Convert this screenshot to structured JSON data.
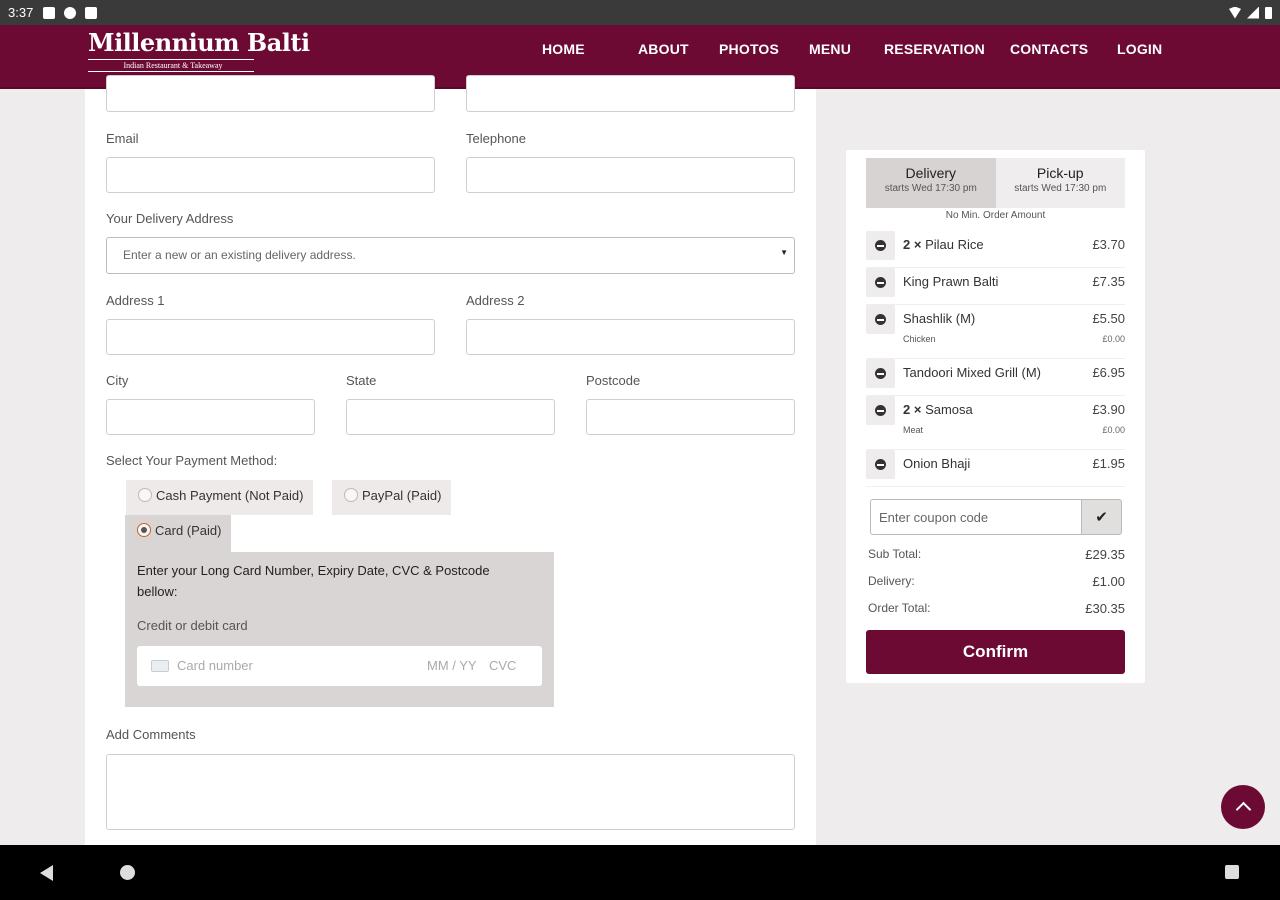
{
  "status_bar": {
    "time": "3:37"
  },
  "header": {
    "logo_title": "Millennium Balti",
    "logo_subtitle": "Indian Restaurant & Takeaway",
    "nav": [
      "HOME",
      "ABOUT",
      "PHOTOS",
      "MENU",
      "RESERVATION",
      "CONTACTS",
      "LOGIN"
    ]
  },
  "form": {
    "email_label": "Email",
    "telephone_label": "Telephone",
    "delivery_address_label": "Your Delivery Address",
    "delivery_address_placeholder": "Enter a new or an existing delivery address.",
    "address1_label": "Address 1",
    "address2_label": "Address 2",
    "city_label": "City",
    "state_label": "State",
    "postcode_label": "Postcode",
    "payment_label": "Select Your Payment Method:",
    "payment_options": [
      "Cash Payment (Not Paid)",
      "PayPal (Paid)",
      "Card (Paid)"
    ],
    "selected_payment": "Card (Paid)",
    "card_instructions": "Enter your Long Card Number, Expiry Date, CVC & Postcode bellow:",
    "card_subtitle": "Credit or debit card",
    "card_number_placeholder": "Card number",
    "card_expiry_placeholder": "MM / YY",
    "card_cvc_placeholder": "CVC",
    "comments_label": "Add Comments"
  },
  "order": {
    "tabs": [
      {
        "label": "Delivery",
        "sub": "starts Wed 17:30 pm",
        "active": true
      },
      {
        "label": "Pick-up",
        "sub": "starts Wed 17:30 pm",
        "active": false
      }
    ],
    "min_order": "No Min. Order Amount",
    "items": [
      {
        "qty": "2 ×",
        "name": "Pilau Rice",
        "price": "£3.70"
      },
      {
        "qty": "",
        "name": "King Prawn Balti",
        "price": "£7.35"
      },
      {
        "qty": "",
        "name": "Shashlik (M)",
        "price": "£5.50",
        "option": "Chicken",
        "option_price": "£0.00"
      },
      {
        "qty": "",
        "name": "Tandoori Mixed Grill (M)",
        "price": "£6.95"
      },
      {
        "qty": "2 ×",
        "name": "Samosa",
        "price": "£3.90",
        "option": "Meat",
        "option_price": "£0.00"
      },
      {
        "qty": "",
        "name": "Onion Bhaji",
        "price": "£1.95"
      }
    ],
    "coupon_placeholder": "Enter coupon code",
    "coupon_button": "✔",
    "sub_total_label": "Sub Total:",
    "sub_total": "£29.35",
    "delivery_label": "Delivery:",
    "delivery": "£1.00",
    "order_total_label": "Order Total:",
    "order_total": "£30.35",
    "confirm_label": "Confirm"
  },
  "colors": {
    "brand": "#6d0a34",
    "panel_grey": "#d9d5d4",
    "page_bg": "#eeecec"
  },
  "icons": [
    "remove-item-icon",
    "checkmark-icon",
    "card-icon",
    "scroll-top-icon",
    "back-icon",
    "home-icon",
    "recents-icon"
  ]
}
